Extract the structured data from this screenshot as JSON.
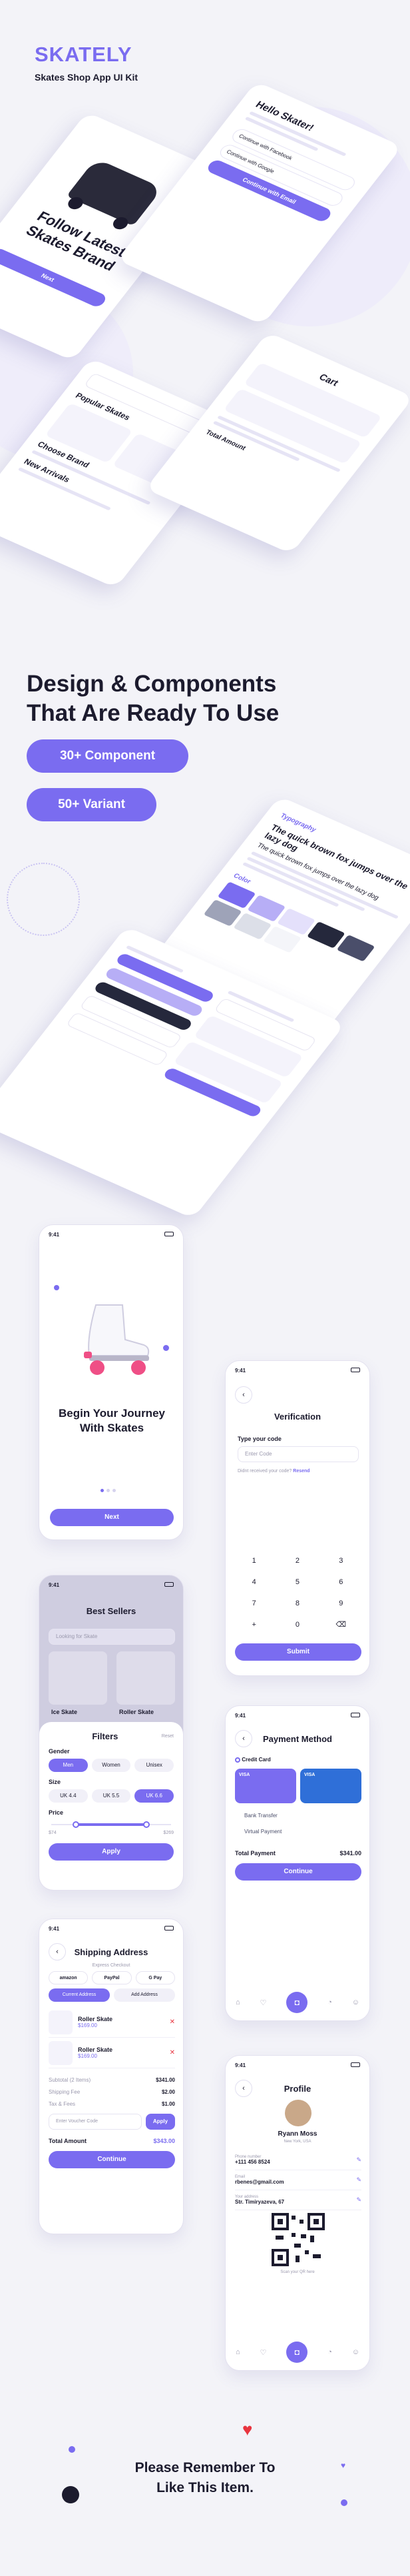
{
  "header": {
    "brand": "SKATELY",
    "subtitle": "Skates Shop App UI Kit"
  },
  "mock1": {
    "title": "Follow Latest Skates Brand",
    "button": "Next"
  },
  "mock2": {
    "title": "Hello Skater!",
    "line1": "Continue with Facebook",
    "line2": "Continue with Google",
    "button": "Continue with Email"
  },
  "mock3": {
    "section1": "Popular Skates",
    "section2": "Choose Brand",
    "section3": "New Arrivals"
  },
  "mock4": {
    "title": "Cart",
    "total": "Total Amount"
  },
  "hero": {
    "line1": "Design & Components",
    "line2": "That Are Ready To Use"
  },
  "badges": {
    "components": "30+ Component",
    "variants": "50+ Variant"
  },
  "typo": {
    "label": "Typography",
    "sample1": "The quick brown fox jumps over the lazy dog",
    "sample2": "The quick brown fox jumps over the lazy dog",
    "color_label": "Color"
  },
  "palette": [
    "#7a6cf0",
    "#b7aef6",
    "#e4e0fb",
    "#25283c",
    "#4a4e6a",
    "#9ea3b8",
    "#dcdfe8",
    "#f4f5f9"
  ],
  "onboard": {
    "time": "9:41",
    "title": "Begin Your Journey With Skates",
    "button": "Next"
  },
  "verify": {
    "time": "9:41",
    "title": "Verification",
    "label": "Type your code",
    "placeholder": "Enter Code",
    "hint": "Didnt received your code?",
    "resend": "Resend",
    "keys": [
      "1",
      "2",
      "3",
      "4",
      "5",
      "6",
      "7",
      "8",
      "9",
      "+",
      "0",
      "⌫"
    ],
    "button": "Submit"
  },
  "filters": {
    "time": "9:41",
    "screen_title": "Best Sellers",
    "search_placeholder": "Looking for Skate",
    "item1": "Ice Skate",
    "item2": "Roller Skate",
    "title": "Filters",
    "reset": "Reset",
    "gender_label": "Gender",
    "genders": [
      "Men",
      "Women",
      "Unisex"
    ],
    "size_label": "Size",
    "sizes": [
      "UK 4.4",
      "UK 5.5",
      "UK 6.6"
    ],
    "price_label": "Price",
    "price_min": "$74",
    "price_max": "$269",
    "button": "Apply"
  },
  "payment": {
    "time": "9:41",
    "title": "Payment Method",
    "methods": [
      "Credit Card",
      "Bank Transfer",
      "Virtual Payment"
    ],
    "card_brand": "VISA",
    "total_label": "Total Payment",
    "total_value": "$341.00",
    "button": "Continue"
  },
  "shipping": {
    "time": "9:41",
    "title": "Shipping Address",
    "express": "Express Checkout",
    "pay_options": [
      "amazon",
      "PayPal",
      "G Pay"
    ],
    "tabs": [
      "Current Address",
      "Add Address"
    ],
    "items": [
      {
        "name": "Roller Skate",
        "price": "$169.00"
      },
      {
        "name": "Roller Skate",
        "price": "$169.00"
      }
    ],
    "summary": [
      {
        "label": "Subtotal (2 Items)",
        "value": "$341.00"
      },
      {
        "label": "Shipping Fee",
        "value": "$2.00"
      },
      {
        "label": "Tax & Fees",
        "value": "$1.00"
      }
    ],
    "voucher_placeholder": "Enter Voucher Code",
    "voucher_button": "Apply",
    "total_label": "Total Amount",
    "total_value": "$343.00",
    "button": "Continue"
  },
  "profile": {
    "time": "9:41",
    "title": "Profile",
    "name": "Ryann Moss",
    "location": "New York, USA",
    "fields": [
      {
        "label": "Phone number",
        "value": "+111 456 8524"
      },
      {
        "label": "Email",
        "value": "rbenes@gmail.com"
      },
      {
        "label": "Your address",
        "value": "Str. Timiryazeva, 67"
      }
    ],
    "qr_caption": "Scan your QR here"
  },
  "footer": {
    "line1": "Please Remember To",
    "line2": "Like This Item."
  }
}
